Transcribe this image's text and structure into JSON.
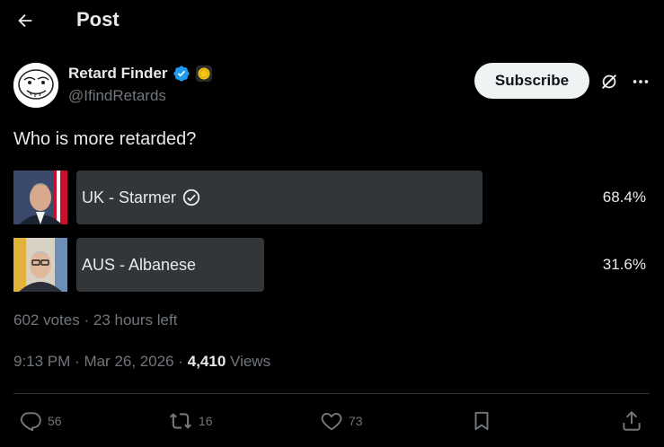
{
  "header": {
    "title": "Post"
  },
  "author": {
    "display_name": "Retard Finder",
    "handle": "@IfindRetards",
    "verified": true,
    "badge_color": "#f5c518"
  },
  "actions": {
    "subscribe_label": "Subscribe"
  },
  "post": {
    "text": "Who is more retarded?"
  },
  "poll": {
    "options": [
      {
        "label": "UK - Starmer",
        "percent_text": "68.4%",
        "percent": 68.4,
        "selected": true
      },
      {
        "label": "AUS - Albanese",
        "percent_text": "31.6%",
        "percent": 31.6,
        "selected": false
      }
    ],
    "votes": "602 votes",
    "time_left": "23 hours left"
  },
  "meta": {
    "time": "9:13 PM",
    "date": "Mar 26, 2026",
    "views_count": "4,410",
    "views_label": "Views"
  },
  "engagement": {
    "replies": "56",
    "reposts": "16",
    "likes": "73"
  },
  "colors": {
    "background": "#000000",
    "text": "#e7e9ea",
    "muted": "#71767b",
    "verified": "#1d9bf0",
    "poll_bar": "#333639"
  }
}
